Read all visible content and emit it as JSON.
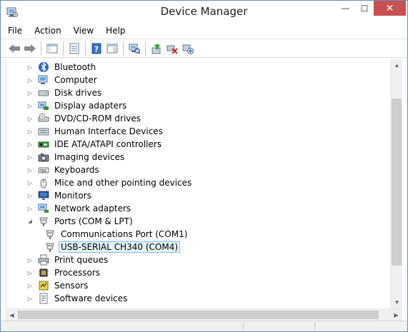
{
  "window": {
    "title": "Device Manager",
    "close_glyph": "✕",
    "minimize_glyph": "—",
    "maximize_glyph": "☐",
    "app_icon": "device-manager-icon"
  },
  "menu": [
    "File",
    "Action",
    "View",
    "Help"
  ],
  "toolbar": [
    "back-arrow-icon",
    "forward-arrow-icon",
    "properties-sheet-icon",
    "list-view-icon",
    "help-icon",
    "show-hidden-icon",
    "monitor-scan-icon",
    "update-driver-icon",
    "disable-device-icon",
    "add-hardware-icon"
  ],
  "tree": {
    "items": [
      {
        "label": "Bluetooth",
        "icon": "bluetooth-icon",
        "indent": 0,
        "expander": "collapsed"
      },
      {
        "label": "Computer",
        "icon": "computer-icon",
        "indent": 0,
        "expander": "collapsed"
      },
      {
        "label": "Disk drives",
        "icon": "disk-drive-icon",
        "indent": 0,
        "expander": "collapsed"
      },
      {
        "label": "Display adapters",
        "icon": "display-adapter-icon",
        "indent": 0,
        "expander": "collapsed"
      },
      {
        "label": "DVD/CD-ROM drives",
        "icon": "dvd-drive-icon",
        "indent": 0,
        "expander": "collapsed"
      },
      {
        "label": "Human Interface Devices",
        "icon": "hid-icon",
        "indent": 0,
        "expander": "collapsed"
      },
      {
        "label": "IDE ATA/ATAPI controllers",
        "icon": "ide-controller-icon",
        "indent": 0,
        "expander": "collapsed"
      },
      {
        "label": "Imaging devices",
        "icon": "camera-icon",
        "indent": 0,
        "expander": "collapsed"
      },
      {
        "label": "Keyboards",
        "icon": "keyboard-icon",
        "indent": 0,
        "expander": "collapsed"
      },
      {
        "label": "Mice and other pointing devices",
        "icon": "mouse-icon",
        "indent": 0,
        "expander": "collapsed"
      },
      {
        "label": "Monitors",
        "icon": "monitor-icon",
        "indent": 0,
        "expander": "collapsed"
      },
      {
        "label": "Network adapters",
        "icon": "network-adapter-icon",
        "indent": 0,
        "expander": "collapsed"
      },
      {
        "label": "Ports (COM & LPT)",
        "icon": "port-icon",
        "indent": 0,
        "expander": "expanded"
      },
      {
        "label": "Communications Port (COM1)",
        "icon": "port-icon",
        "indent": 1,
        "expander": "none"
      },
      {
        "label": "USB-SERIAL CH340 (COM4)",
        "icon": "port-icon",
        "indent": 1,
        "expander": "none",
        "selected": true
      },
      {
        "label": "Print queues",
        "icon": "printer-icon",
        "indent": 0,
        "expander": "collapsed"
      },
      {
        "label": "Processors",
        "icon": "processor-icon",
        "indent": 0,
        "expander": "collapsed"
      },
      {
        "label": "Sensors",
        "icon": "sensor-icon",
        "indent": 0,
        "expander": "collapsed"
      },
      {
        "label": "Software devices",
        "icon": "software-device-icon",
        "indent": 0,
        "expander": "collapsed"
      }
    ]
  },
  "colors": {
    "selection_bg": "#e5f3fb",
    "selection_border": "#7dc0ec",
    "close_button": "#c75050",
    "frame": "#6b8fb8"
  }
}
